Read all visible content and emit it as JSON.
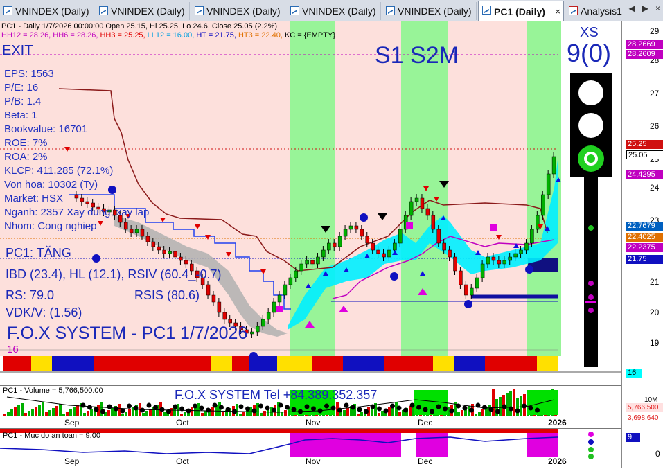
{
  "tabs": [
    {
      "label": "VNINDEX (Daily)"
    },
    {
      "label": "VNINDEX (Daily)"
    },
    {
      "label": "VNINDEX (Daily)"
    },
    {
      "label": "VNINDEX (Daily)"
    },
    {
      "label": "VNINDEX (Daily)"
    },
    {
      "label": "PC1 (Daily)",
      "close": "×"
    },
    {
      "label": "Analysis1"
    }
  ],
  "tab_nav": {
    "prev": "◀",
    "next": "▶",
    "close": "×"
  },
  "header": {
    "line1": "PC1 - Daily 1/7/2026 00:00:00 Open 25.15, Hi 25.25, Lo 24.6, Close 25.05 (2.2%)",
    "line2_parts": [
      {
        "text": "HH12 = 28.26, HH6 = 28.26, ",
        "color": "#c000c0"
      },
      {
        "text": "HH3 = 25.25, ",
        "color": "#e00000"
      },
      {
        "text": "LL12 = 16.00, ",
        "color": "#00a0e0"
      },
      {
        "text": "HT = 21.75, ",
        "color": "#0000c0"
      },
      {
        "text": "HT3 = 22.40, ",
        "color": "#e07000"
      },
      {
        "text": "KC = {EMPTY}",
        "color": "#000000"
      }
    ]
  },
  "fundamentals": {
    "exit": "EXIT",
    "items": [
      "EPS: 1563",
      "P/E: 16",
      "P/B: 1.4",
      "Beta: 1",
      "Bookvalue: 16701",
      "ROE: 7%",
      "ROA: 2%",
      "KLCP: 411.285 (72.1%)",
      "Von hoa: 10302 (Ty)",
      "Market: HSX",
      "Nganh: 2357 Xay dung, xay lap",
      "Nhom: Cong nghiep"
    ],
    "trend": "PC1: TĂNG",
    "ibd": "IBD (23.4), HL (12.1), RSIV (60.4_-0.7)",
    "rs": "RS: 79.0",
    "rsis": "RSIS (80.6)",
    "vdk": "VDK/V:  (1.56)",
    "system_title": "F.O.X SYSTEM - PC1 1/7/2026",
    "small_num": "16"
  },
  "signal": {
    "label": "S1  S2M"
  },
  "traffic": {
    "xs_label": "XS",
    "xs_value": "9(0)"
  },
  "price_axis": {
    "ticks": [
      "29",
      "28",
      "27",
      "26",
      "25",
      "24",
      "23",
      "22",
      "21",
      "20",
      "19"
    ],
    "labels": [
      {
        "text": "28.2669",
        "color": "#c000c0"
      },
      {
        "text": "28.2609",
        "color": "#c000c0"
      },
      {
        "text": "25.25",
        "color": "#d01010"
      },
      {
        "text": "25.05",
        "color": "#000000"
      },
      {
        "text": "24.4295",
        "color": "#c000c0"
      },
      {
        "text": "22.7679",
        "color": "#0060c0"
      },
      {
        "text": "22.4025",
        "color": "#e07000"
      },
      {
        "text": "22.2375",
        "color": "#c000c0"
      },
      {
        "text": "21.75",
        "color": "#1010c0"
      }
    ],
    "extra": "16"
  },
  "x_dates": [
    "Sep",
    "Oct",
    "Nov",
    "Dec",
    "2026"
  ],
  "volume": {
    "label": "PC1 - Volume = 5,766,500.00",
    "banner": "F.O.X SYSTEM Tel +84.389.352.357",
    "axis_tick": "10M",
    "labels": [
      {
        "text": "5,766,500",
        "color": "#e02020"
      },
      {
        "text": "3,698,640",
        "color": "#e02020"
      }
    ]
  },
  "safety": {
    "label": "PC1 - Muc do an toan = 9.00",
    "axis_value": "9",
    "axis_zero": "0"
  },
  "colors": {
    "up": "#00b000",
    "down": "#e00000",
    "green_zone": "#98f498",
    "pink_zone": "#fde0dc",
    "cyan_band": "#00f0ff"
  }
}
